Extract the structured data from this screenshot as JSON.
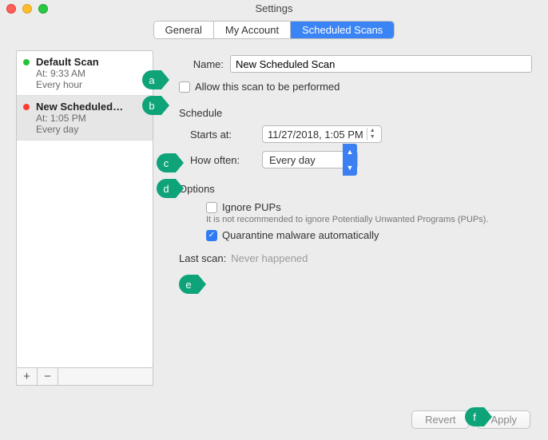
{
  "window": {
    "title": "Settings"
  },
  "tabs": {
    "general": "General",
    "account": "My Account",
    "scans": "Scheduled Scans"
  },
  "sidebar": {
    "items": [
      {
        "name": "Default Scan",
        "time": "At: 9:33 AM",
        "freq": "Every hour",
        "status": "green"
      },
      {
        "name": "New Scheduled…",
        "time": "At: 1:05 PM",
        "freq": "Every day",
        "status": "red"
      }
    ]
  },
  "detail": {
    "name_label": "Name:",
    "name_value": "New Scheduled Scan",
    "allow_label": "Allow this scan to be performed",
    "schedule_title": "Schedule",
    "starts_label": "Starts at:",
    "starts_value": "11/27/2018,   1:05 PM",
    "howoften_label": "How often:",
    "howoften_value": "Every day",
    "options_title": "Options",
    "ignore_label": "Ignore PUPs",
    "ignore_hint": "It is not recommended to ignore Potentially Unwanted Programs (PUPs).",
    "quarantine_label": "Quarantine malware automatically",
    "lastscan_label": "Last scan:",
    "lastscan_value": "Never happened"
  },
  "footer": {
    "revert": "Revert",
    "apply": "Apply"
  },
  "callouts": {
    "a": "a",
    "b": "b",
    "c": "c",
    "d": "d",
    "e": "e",
    "f": "f"
  }
}
